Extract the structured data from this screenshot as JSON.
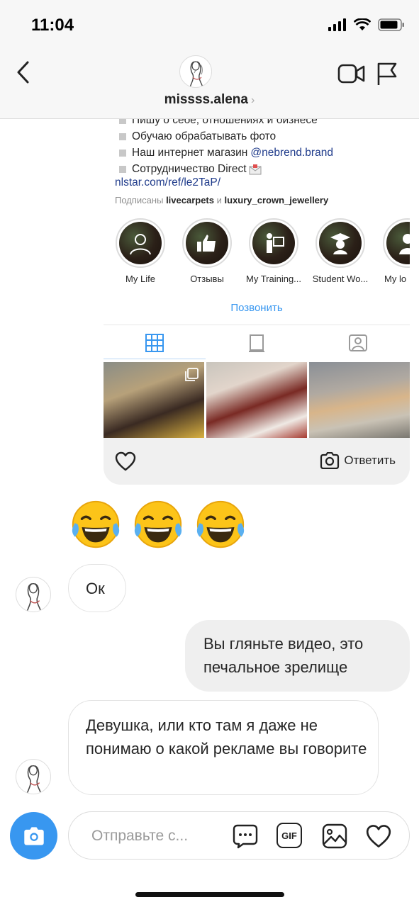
{
  "status": {
    "time": "11:04"
  },
  "header": {
    "username": "missss.alena",
    "chevron": "›"
  },
  "shared_profile": {
    "bio_lines": [
      "Пишу о себе, отношениях и бизнесе",
      "Обучаю обрабатывать фото",
      "Наш интернет магазин",
      "Сотрудничество Direct"
    ],
    "mention": "@nebrend.brand",
    "link": "nlstar.com/ref/le2TaP/",
    "followed_by_prefix": "Подписаны",
    "followed_by_1": "livecarpets",
    "followed_by_and": "и",
    "followed_by_2": "luxury_crown_jewellery",
    "highlights": [
      {
        "label": "My Life"
      },
      {
        "label": "Отзывы"
      },
      {
        "label": "My Training..."
      },
      {
        "label": "Student Wo..."
      },
      {
        "label": "My lo"
      }
    ],
    "call_label": "Позвонить",
    "reply_label": "Ответить"
  },
  "messages": [
    {
      "from": "them",
      "text": "Ок"
    },
    {
      "from": "me",
      "text": "Вы гляньте видео, это печальное зрелище"
    },
    {
      "from": "them",
      "text": "Девушка, или кто там я даже не понимаю о какой рекламе вы говорите"
    }
  ],
  "composer": {
    "placeholder": "Отправьте с...",
    "gif_label": "GIF"
  },
  "colors": {
    "accent": "#3897f0",
    "link": "#1e3a8a",
    "bubble_out": "#efefef"
  }
}
